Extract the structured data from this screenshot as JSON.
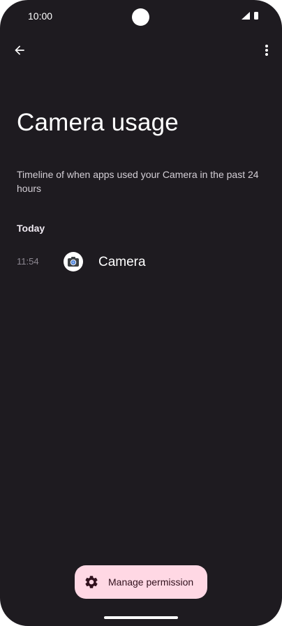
{
  "status_bar": {
    "time": "10:00",
    "icons": [
      "signal-icon",
      "battery-icon"
    ]
  },
  "top_bar": {
    "back_icon": "arrow-back-icon",
    "more_icon": "more-vert-icon"
  },
  "page": {
    "title": "Camera usage",
    "subtitle": "Timeline of when apps used your Camera in the past 24 hours"
  },
  "timeline": {
    "section_header": "Today",
    "entries": [
      {
        "time": "11:54",
        "app_name": "Camera",
        "icon": "camera-app-icon"
      }
    ]
  },
  "footer": {
    "manage_label": "Manage permission",
    "manage_icon": "gear-icon"
  },
  "colors": {
    "background": "#1e1b20",
    "button_bg": "#ffd8e4",
    "button_text": "#31111d",
    "primary_text": "#ffffff",
    "secondary_text": "#d4cfd6",
    "muted_text": "#8d8892"
  }
}
